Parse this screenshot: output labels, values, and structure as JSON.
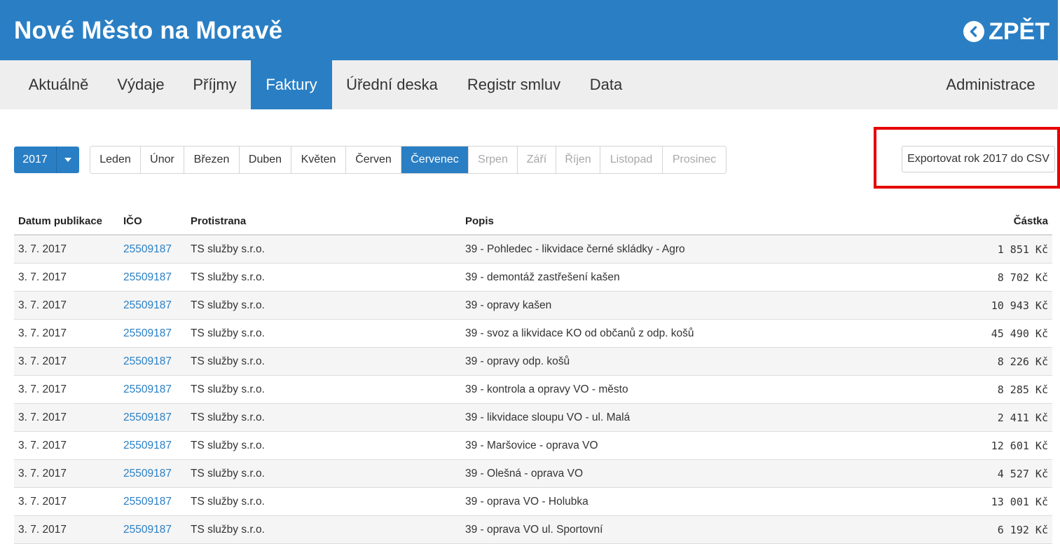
{
  "header": {
    "title": "Nové Město na Moravě",
    "back_label": "ZPĚT"
  },
  "nav": {
    "items": [
      {
        "label": "Aktuálně"
      },
      {
        "label": "Výdaje"
      },
      {
        "label": "Příjmy"
      },
      {
        "label": "Faktury",
        "active": true
      },
      {
        "label": "Úřední deska"
      },
      {
        "label": "Registr smluv"
      },
      {
        "label": "Data"
      }
    ],
    "admin_label": "Administrace"
  },
  "filters": {
    "year": "2017",
    "months": [
      {
        "label": "Leden"
      },
      {
        "label": "Únor"
      },
      {
        "label": "Březen"
      },
      {
        "label": "Duben"
      },
      {
        "label": "Květen"
      },
      {
        "label": "Červen"
      },
      {
        "label": "Červenec",
        "active": true
      },
      {
        "label": "Srpen",
        "disabled": true
      },
      {
        "label": "Září",
        "disabled": true
      },
      {
        "label": "Říjen",
        "disabled": true
      },
      {
        "label": "Listopad",
        "disabled": true
      },
      {
        "label": "Prosinec",
        "disabled": true
      }
    ],
    "export_label": "Exportovat rok 2017 do CSV"
  },
  "colors": {
    "brand_blue": "#2a7fc4",
    "highlight_red": "#e60000"
  },
  "table": {
    "headers": {
      "date": "Datum publikace",
      "ico": "IČO",
      "party": "Protistrana",
      "description": "Popis",
      "amount": "Částka"
    },
    "rows": [
      {
        "date": "3. 7. 2017",
        "ico": "25509187",
        "party": "TS služby s.r.o.",
        "description": "39 - Pohledec - likvidace černé skládky - Agro",
        "amount": "1 851 Kč"
      },
      {
        "date": "3. 7. 2017",
        "ico": "25509187",
        "party": "TS služby s.r.o.",
        "description": "39 - demontáž zastřešení kašen",
        "amount": "8 702 Kč"
      },
      {
        "date": "3. 7. 2017",
        "ico": "25509187",
        "party": "TS služby s.r.o.",
        "description": "39 - opravy kašen",
        "amount": "10 943 Kč"
      },
      {
        "date": "3. 7. 2017",
        "ico": "25509187",
        "party": "TS služby s.r.o.",
        "description": "39 - svoz a likvidace KO od občanů z odp. košů",
        "amount": "45 490 Kč"
      },
      {
        "date": "3. 7. 2017",
        "ico": "25509187",
        "party": "TS služby s.r.o.",
        "description": "39 - opravy odp. košů",
        "amount": "8 226 Kč"
      },
      {
        "date": "3. 7. 2017",
        "ico": "25509187",
        "party": "TS služby s.r.o.",
        "description": "39 - kontrola a opravy VO - město",
        "amount": "8 285 Kč"
      },
      {
        "date": "3. 7. 2017",
        "ico": "25509187",
        "party": "TS služby s.r.o.",
        "description": "39 - likvidace sloupu VO - ul. Malá",
        "amount": "2 411 Kč"
      },
      {
        "date": "3. 7. 2017",
        "ico": "25509187",
        "party": "TS služby s.r.o.",
        "description": "39 - Maršovice - oprava VO",
        "amount": "12 601 Kč"
      },
      {
        "date": "3. 7. 2017",
        "ico": "25509187",
        "party": "TS služby s.r.o.",
        "description": "39 - Olešná - oprava VO",
        "amount": "4 527 Kč"
      },
      {
        "date": "3. 7. 2017",
        "ico": "25509187",
        "party": "TS služby s.r.o.",
        "description": "39 - oprava VO - Holubka",
        "amount": "13 001 Kč"
      },
      {
        "date": "3. 7. 2017",
        "ico": "25509187",
        "party": "TS služby s.r.o.",
        "description": "39 - oprava VO ul. Sportovní",
        "amount": "6 192 Kč"
      }
    ]
  }
}
